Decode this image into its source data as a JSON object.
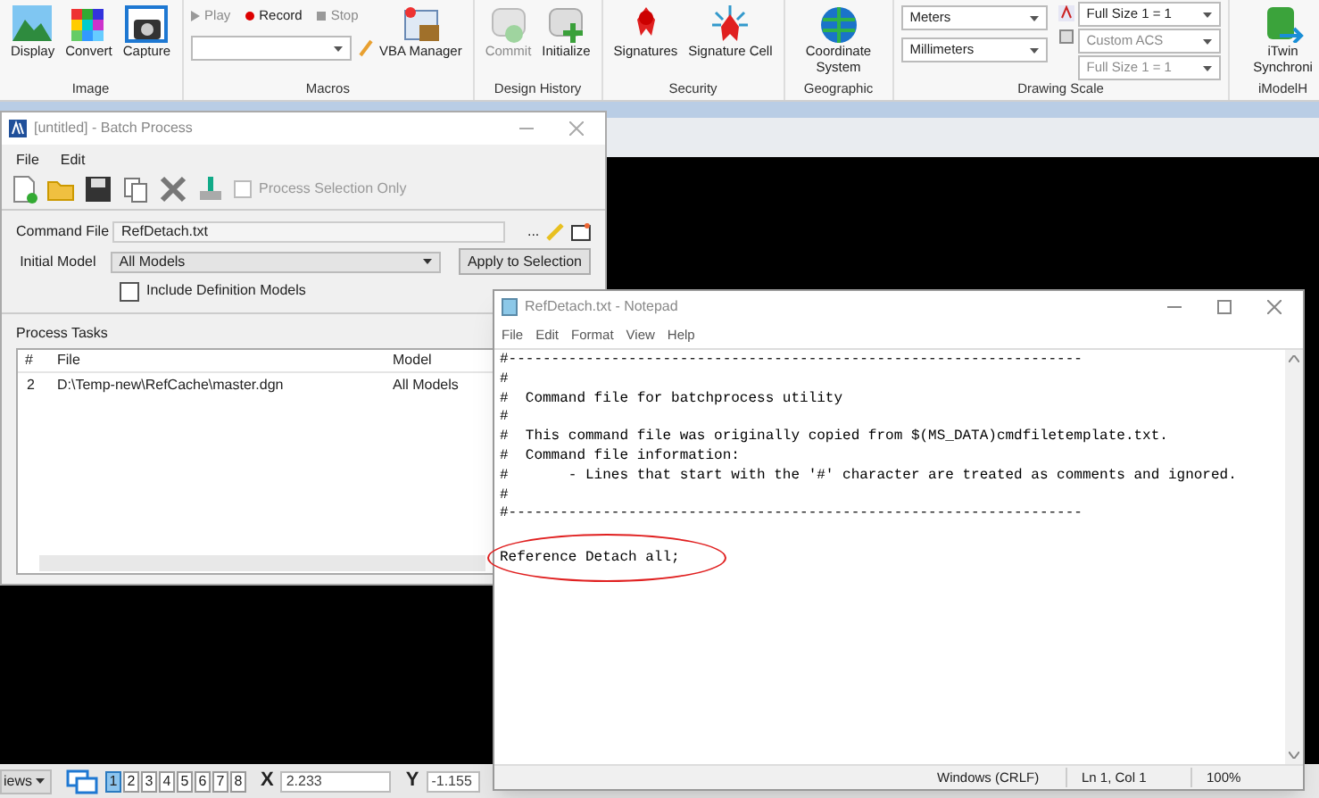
{
  "ribbon": {
    "groups": [
      {
        "label": "Image",
        "kind": "big",
        "buttons": [
          {
            "label": "Display"
          },
          {
            "label": "Convert"
          },
          {
            "label": "Capture"
          }
        ]
      },
      {
        "label": "Macros",
        "kind": "macros",
        "controls": [
          {
            "label": "Play",
            "disabled": true
          },
          {
            "label": "Record",
            "disabled": false
          },
          {
            "label": "Stop",
            "disabled": true
          }
        ],
        "buttons": [
          {
            "label": "VBA Manager"
          }
        ]
      },
      {
        "label": "Design History",
        "kind": "big",
        "buttons": [
          {
            "label": "Commit",
            "disabled": true
          },
          {
            "label": "Initialize",
            "disabled": false
          }
        ]
      },
      {
        "label": "Security",
        "kind": "big",
        "buttons": [
          {
            "label": "Signatures"
          },
          {
            "label": "Signature Cell"
          }
        ]
      },
      {
        "label": "Geographic",
        "kind": "big",
        "buttons": [
          {
            "label": "Coordinate System"
          }
        ]
      },
      {
        "label": "Drawing Scale",
        "kind": "scale",
        "units": [
          "Meters",
          "Millimeters"
        ],
        "scales": [
          {
            "value": "Full Size 1 = 1",
            "disabled": false
          },
          {
            "value": "Custom ACS",
            "disabled": true
          },
          {
            "value": "Full Size 1 = 1",
            "disabled": true
          }
        ]
      },
      {
        "label": "iModelH",
        "kind": "big",
        "buttons": [
          {
            "label": "iTwin Synchroni"
          }
        ]
      }
    ]
  },
  "batch_window": {
    "title": "[untitled] - Batch Process",
    "menu": [
      "File",
      "Edit"
    ],
    "process_selection_only": {
      "label": "Process Selection Only",
      "checked": false
    },
    "command_file": {
      "label": "Command File",
      "value": "RefDetach.txt",
      "browse": "..."
    },
    "initial_model": {
      "label": "Initial Model",
      "value": "All Models"
    },
    "apply_button": "Apply to Selection",
    "include_definition_models": {
      "label": "Include Definition Models",
      "checked": false
    },
    "process_tasks": {
      "title": "Process Tasks",
      "columns": [
        "#",
        "File",
        "Model"
      ],
      "rows": [
        [
          "2",
          "D:\\Temp-new\\RefCache\\master.dgn",
          "All Models"
        ]
      ]
    }
  },
  "notepad": {
    "title": "RefDetach.txt - Notepad",
    "menu": [
      "File",
      "Edit",
      "Format",
      "View",
      "Help"
    ],
    "lines": [
      "#-------------------------------------------------------------------",
      "#",
      "#  Command file for batchprocess utility",
      "#",
      "#  This command file was originally copied from $(MS_DATA)cmdfiletemplate.txt.",
      "#  Command file information:",
      "#       - Lines that start with the '#' character are treated as comments and ignored.",
      "#",
      "#-------------------------------------------------------------------",
      "Reference Detach all;"
    ],
    "status": [
      "Windows (CRLF)",
      "Ln 1, Col 1",
      "100%"
    ]
  },
  "status_bar": {
    "views_label": "iews",
    "views": [
      {
        "label": "1",
        "selected": true
      },
      {
        "label": "2",
        "selected": false
      },
      {
        "label": "3",
        "selected": false
      },
      {
        "label": "4",
        "selected": false
      },
      {
        "label": "5",
        "selected": false
      },
      {
        "label": "6",
        "selected": false
      },
      {
        "label": "7",
        "selected": false
      },
      {
        "label": "8",
        "selected": false
      }
    ],
    "x": {
      "label": "X",
      "value": "2.233"
    },
    "y": {
      "label": "Y",
      "value": "-1.155"
    }
  }
}
